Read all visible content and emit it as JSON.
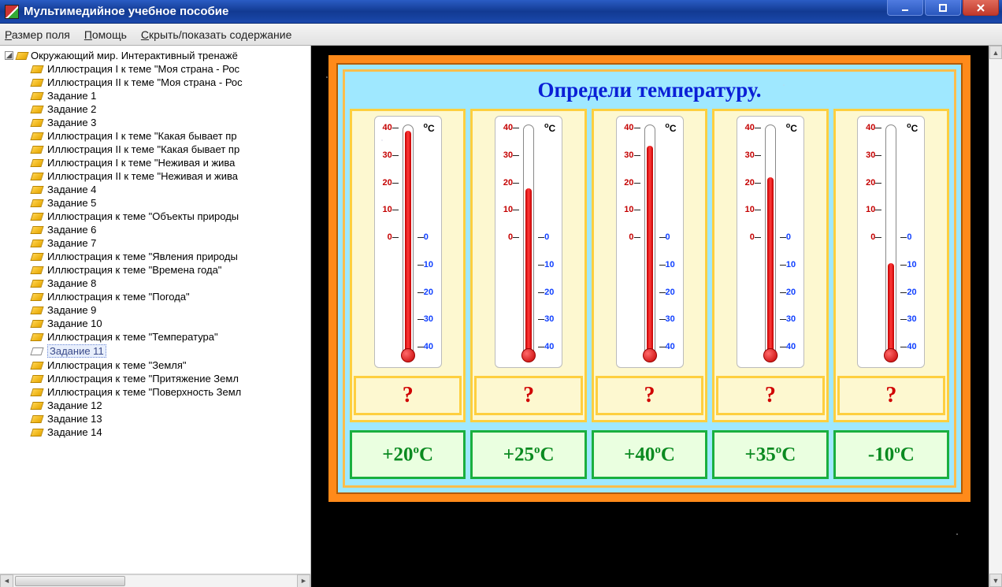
{
  "window": {
    "title": "Мультимедийное учебное пособие"
  },
  "menu": {
    "items": [
      "Размер поля",
      "Помощь",
      "Скрыть/показать содержание"
    ]
  },
  "tree": {
    "root": "Окружающий мир. Интерактивный тренажё",
    "items": [
      {
        "label": "Иллюстрация I к теме \"Моя страна - Рос"
      },
      {
        "label": "Иллюстрация II к теме \"Моя страна - Рос"
      },
      {
        "label": "Задание 1"
      },
      {
        "label": "Задание 2"
      },
      {
        "label": "Задание 3"
      },
      {
        "label": "Иллюстрация I к теме \"Какая бывает пр"
      },
      {
        "label": "Иллюстрация II к теме \"Какая бывает пр"
      },
      {
        "label": "Иллюстрация I к теме \"Неживая и жива"
      },
      {
        "label": "Иллюстрация II к теме \"Неживая и жива"
      },
      {
        "label": "Задание 4"
      },
      {
        "label": "Задание 5"
      },
      {
        "label": "Иллюстрация к теме \"Объекты природы"
      },
      {
        "label": "Задание 6"
      },
      {
        "label": "Задание 7"
      },
      {
        "label": "Иллюстрация к теме \"Явления природы"
      },
      {
        "label": "Иллюстрация к теме \"Времена года\""
      },
      {
        "label": "Задание 8"
      },
      {
        "label": "Иллюстрация к теме \"Погода\""
      },
      {
        "label": "Задание 9"
      },
      {
        "label": "Задание 10"
      },
      {
        "label": "Иллюстрация к теме \"Температура\""
      },
      {
        "label": "Задание 11",
        "selected": true
      },
      {
        "label": "Иллюстрация к теме \"Земля\""
      },
      {
        "label": "Иллюстрация к теме \"Притяжение Земл"
      },
      {
        "label": "Иллюстрация к теме \"Поверхность Земл"
      },
      {
        "label": "Задание 12"
      },
      {
        "label": "Задание 13"
      },
      {
        "label": "Задание 14"
      }
    ]
  },
  "exercise": {
    "title": "Определи температуру.",
    "unit_label": "°C",
    "question_mark": "?",
    "scale": {
      "top_labels_left": [
        "40",
        "30",
        "20",
        "10",
        "0"
      ],
      "bottom_labels_right": [
        "0",
        "10",
        "20",
        "30",
        "40"
      ]
    },
    "thermometers": [
      {
        "temp_c": 38
      },
      {
        "temp_c": 18
      },
      {
        "temp_c": 33
      },
      {
        "temp_c": 22
      },
      {
        "temp_c": -8
      }
    ],
    "answers": [
      "+20ºC",
      "+25ºC",
      "+40ºC",
      "+35ºC",
      "-10ºC"
    ]
  }
}
